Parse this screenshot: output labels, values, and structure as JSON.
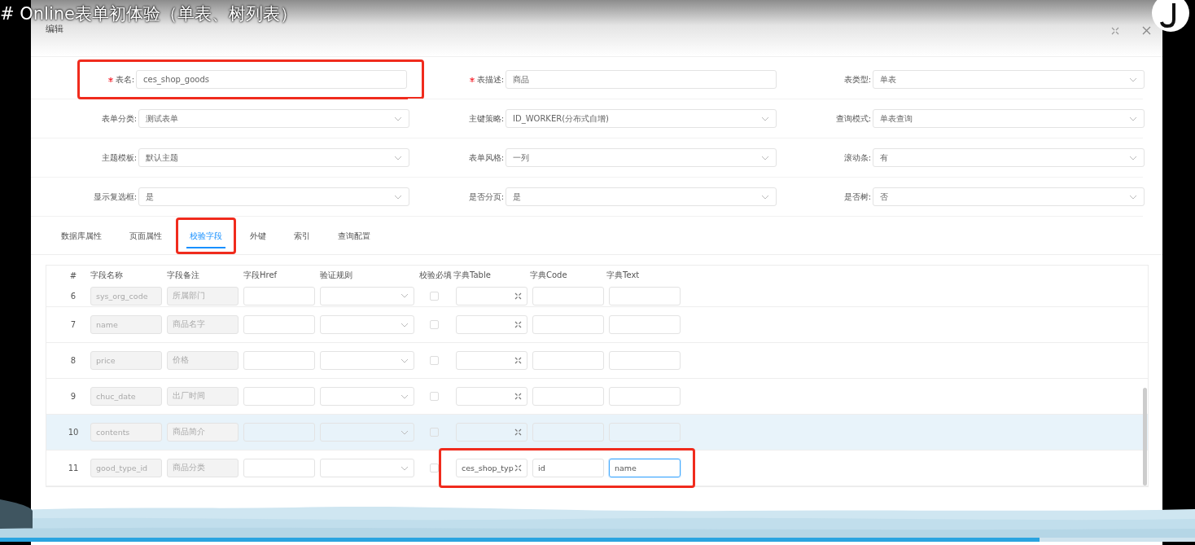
{
  "caption": "# Online表单初体验（单表、树列表）",
  "dialog": {
    "title": "编辑"
  },
  "form": [
    {
      "label": "表名:",
      "value": "ces_shop_goods",
      "required": true,
      "kind": "input",
      "highlighted": true
    },
    {
      "label": "表描述:",
      "value": "商品",
      "required": true,
      "kind": "input",
      "highlighted": false
    },
    {
      "label": "表类型:",
      "value": "单表",
      "required": false,
      "kind": "select",
      "highlighted": false
    },
    {
      "label": "表单分类:",
      "value": "测试表单",
      "required": false,
      "kind": "select",
      "highlighted": false
    },
    {
      "label": "主键策略:",
      "value": "ID_WORKER(分布式自增)",
      "required": false,
      "kind": "select",
      "highlighted": false
    },
    {
      "label": "查询模式:",
      "value": "单表查询",
      "required": false,
      "kind": "select",
      "highlighted": false
    },
    {
      "label": "主题模板:",
      "value": "默认主题",
      "required": false,
      "kind": "select",
      "highlighted": false
    },
    {
      "label": "表单风格:",
      "value": "一列",
      "required": false,
      "kind": "select",
      "highlighted": false
    },
    {
      "label": "滚动条:",
      "value": "有",
      "required": false,
      "kind": "select",
      "highlighted": false
    },
    {
      "label": "显示复选框:",
      "value": "是",
      "required": false,
      "kind": "select",
      "highlighted": false
    },
    {
      "label": "是否分页:",
      "value": "是",
      "required": false,
      "kind": "select",
      "highlighted": false
    },
    {
      "label": "是否树:",
      "value": "否",
      "required": false,
      "kind": "select",
      "highlighted": false
    }
  ],
  "tabs": [
    {
      "label": "数据库属性",
      "selected": false,
      "highlighted": false
    },
    {
      "label": "页面属性",
      "selected": false,
      "highlighted": false
    },
    {
      "label": "校验字段",
      "selected": true,
      "highlighted": true
    },
    {
      "label": "外键",
      "selected": false,
      "highlighted": false
    },
    {
      "label": "索引",
      "selected": false,
      "highlighted": false
    },
    {
      "label": "查询配置",
      "selected": false,
      "highlighted": false
    }
  ],
  "table": {
    "columns": [
      "#",
      "字段名称",
      "字段备注",
      "字段Href",
      "验证规则",
      "校验必填",
      "字典Table",
      "字典Code",
      "字典Text"
    ],
    "rows": [
      {
        "no": "6",
        "field_name": "sys_org_code",
        "remark": "所属部门",
        "required": false,
        "dict_text_focused": false,
        "hovered": false,
        "highlighted": false
      },
      {
        "no": "7",
        "field_name": "name",
        "remark": "商品名字",
        "required": false,
        "dict_text_focused": false,
        "hovered": false,
        "highlighted": false
      },
      {
        "no": "8",
        "field_name": "price",
        "remark": "价格",
        "required": false,
        "dict_text_focused": false,
        "hovered": false,
        "highlighted": false
      },
      {
        "no": "9",
        "field_name": "chuc_date",
        "remark": "出厂时间",
        "required": false,
        "dict_text_focused": false,
        "hovered": false,
        "highlighted": false
      },
      {
        "no": "10",
        "field_name": "contents",
        "remark": "商品简介",
        "required": false,
        "dict_text_focused": false,
        "hovered": true,
        "highlighted": false
      },
      {
        "no": "11",
        "field_name": "good_type_id",
        "remark": "商品分类",
        "required": false,
        "dict_table": "ces_shop_typ",
        "dict_code": "id",
        "dict_text": "name",
        "dict_text_focused": true,
        "hovered": false,
        "highlighted": true
      }
    ]
  },
  "video_progress": {
    "level": 0.87
  }
}
